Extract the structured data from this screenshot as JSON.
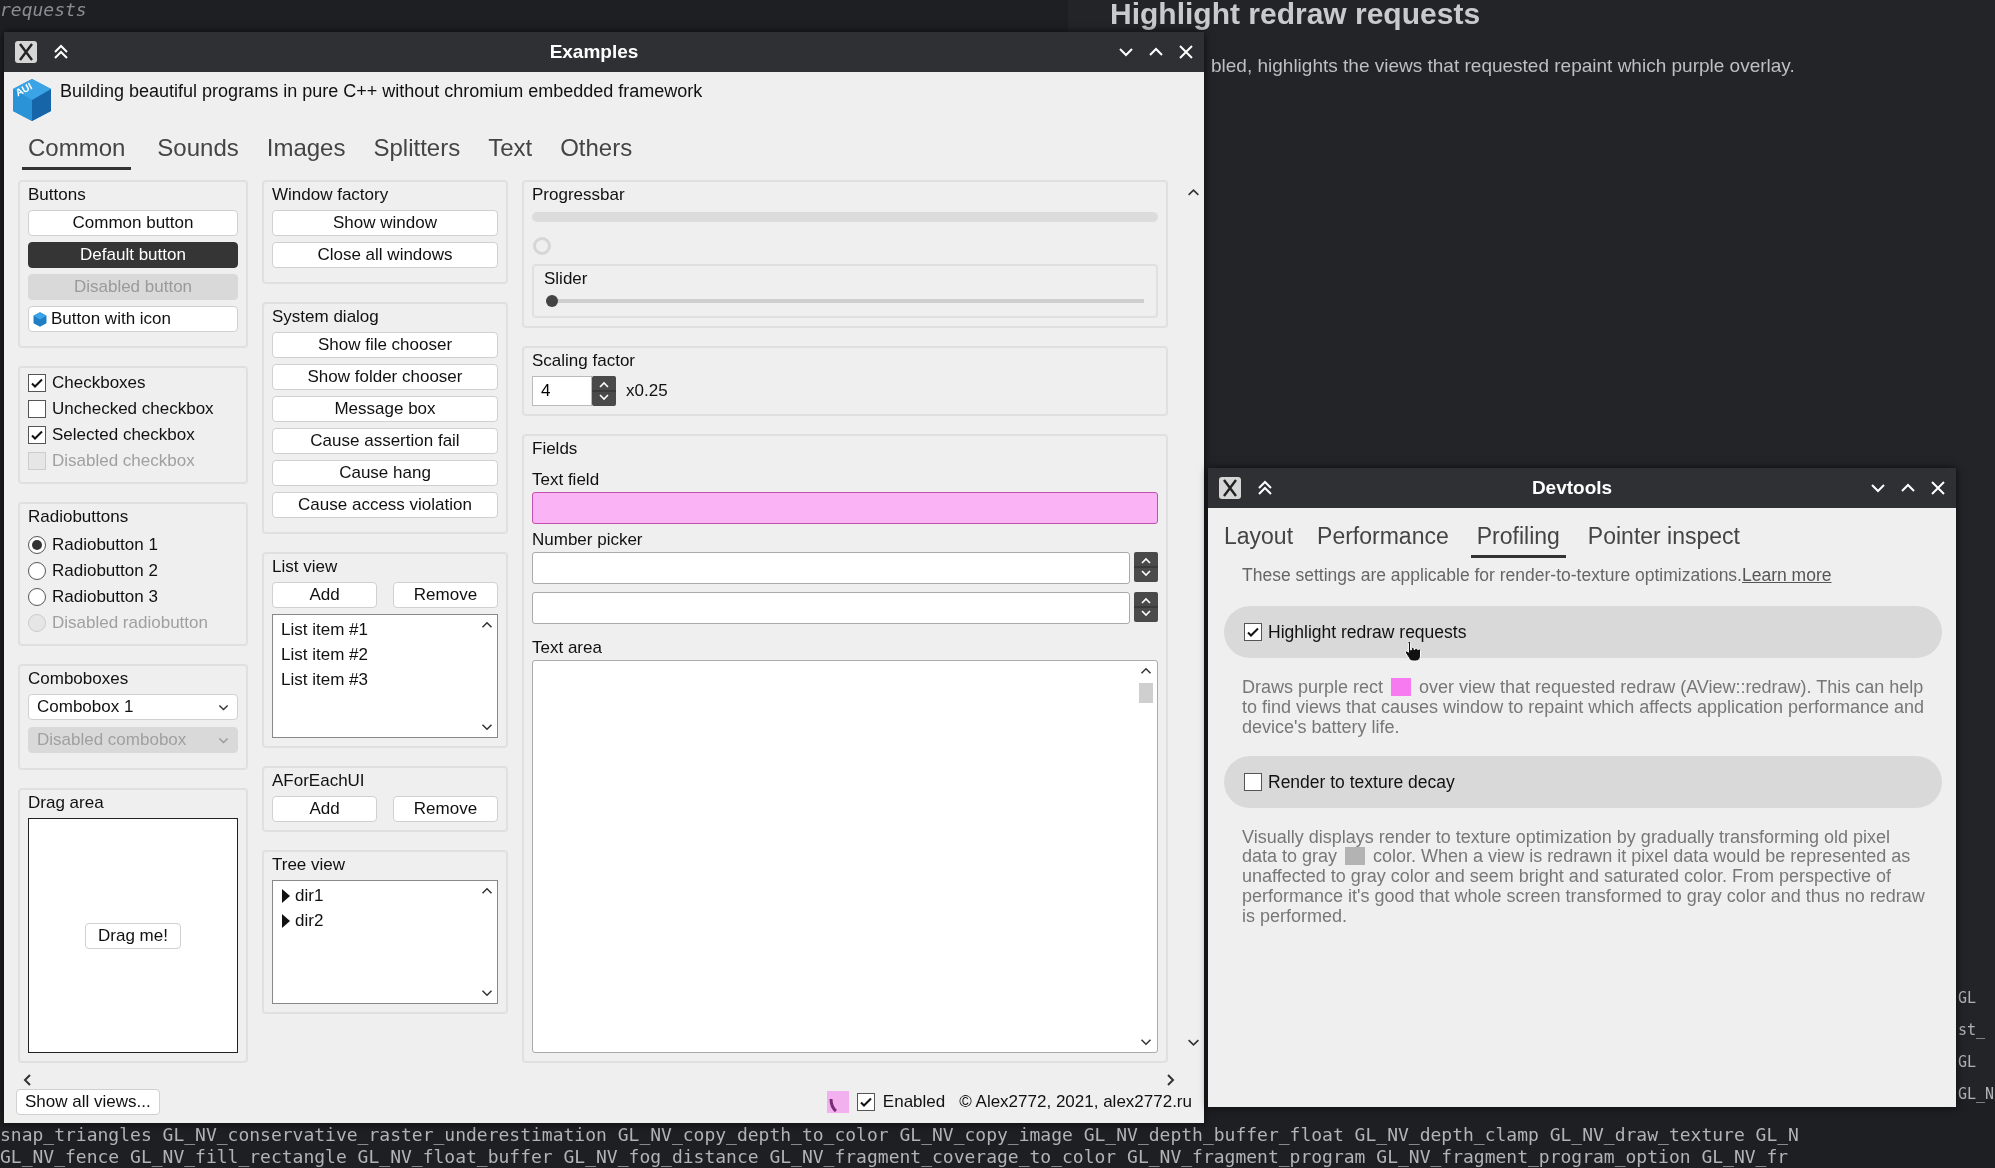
{
  "background": {
    "code_text": "requests",
    "heading": "Highlight redraw requests",
    "paragraph": "bled, highlights the views that requested repaint which purple overlay.",
    "bottom_lines": [
      "snap_triangles GL_NV_conservative_raster_underestimation GL_NV_copy_depth_to_color GL_NV_copy_image GL_NV_depth_buffer_float GL_NV_depth_clamp GL_NV_draw_texture GL_N",
      "GL_NV_fence GL_NV_fill_rectangle GL_NV_float_buffer GL_NV_fog_distance GL_NV_fragment_coverage_to_color GL_NV_fragment_program GL_NV_fragment_program_option GL_NV_fr"
    ],
    "right_fragments": [
      "GL",
      "st_",
      "GL",
      "GL_N"
    ]
  },
  "examples_window": {
    "title": "Examples",
    "logo_text": "AUI",
    "header_text": "Building beautiful programs in pure C++ without chromium embedded framework",
    "tabs": [
      {
        "label": "Common",
        "selected": true
      },
      {
        "label": "Sounds",
        "selected": false
      },
      {
        "label": "Images",
        "selected": false
      },
      {
        "label": "Splitters",
        "selected": false
      },
      {
        "label": "Text",
        "selected": false
      },
      {
        "label": "Others",
        "selected": false
      }
    ],
    "buttons_group": {
      "title": "Buttons",
      "buttons": [
        {
          "label": "Common button",
          "kind": "common"
        },
        {
          "label": "Default button",
          "kind": "default"
        },
        {
          "label": "Disabled button",
          "kind": "disabled"
        },
        {
          "label": "Button with icon",
          "kind": "icon"
        }
      ]
    },
    "checkboxes_group": {
      "title": "Checkboxes",
      "checked": true,
      "items": [
        {
          "label": "Unchecked checkbox",
          "checked": false,
          "disabled": false
        },
        {
          "label": "Selected checkbox",
          "checked": true,
          "disabled": false
        },
        {
          "label": "Disabled checkbox",
          "checked": false,
          "disabled": true
        }
      ]
    },
    "radio_group": {
      "title": "Radiobuttons",
      "items": [
        {
          "label": "Radiobutton 1",
          "selected": true,
          "disabled": false
        },
        {
          "label": "Radiobutton 2",
          "selected": false,
          "disabled": false
        },
        {
          "label": "Radiobutton 3",
          "selected": false,
          "disabled": false
        },
        {
          "label": "Disabled radiobutton",
          "selected": false,
          "disabled": true
        }
      ]
    },
    "combobox_group": {
      "title": "Comboboxes",
      "items": [
        {
          "value": "Combobox 1",
          "disabled": false
        },
        {
          "value": "Disabled combobox",
          "disabled": true
        }
      ]
    },
    "drag_group": {
      "title": "Drag area",
      "button": "Drag me!"
    },
    "window_factory": {
      "title": "Window factory",
      "buttons": [
        "Show window",
        "Close all windows"
      ]
    },
    "system_dialog": {
      "title": "System dialog",
      "buttons": [
        "Show file chooser",
        "Show folder chooser",
        "Message box",
        "Cause assertion fail",
        "Cause hang",
        "Cause access violation"
      ]
    },
    "list_view": {
      "title": "List view",
      "buttons": [
        "Add",
        "Remove"
      ],
      "items": [
        "List item #1",
        "List item #2",
        "List item #3"
      ]
    },
    "foreach": {
      "title": "AForEachUI",
      "buttons": [
        "Add",
        "Remove"
      ]
    },
    "tree_view": {
      "title": "Tree view",
      "items": [
        {
          "label": "dir1",
          "expanded": false
        },
        {
          "label": "dir2",
          "expanded": false
        }
      ]
    },
    "progressbar": {
      "title": "Progressbar",
      "level": 0,
      "slider": {
        "label": "Slider",
        "level": 0
      }
    },
    "scaling": {
      "title": "Scaling factor",
      "value": "4",
      "suffix": "x0.25"
    },
    "fields": {
      "title": "Fields",
      "text_field_label": "Text field",
      "text_field_highlighted": true,
      "number_picker_label": "Number picker",
      "text_area_label": "Text area"
    },
    "status": {
      "button": "Show all views...",
      "enabled_checked": true,
      "enabled_label": "Enabled",
      "copyright": "© Alex2772, 2021, alex2772.ru"
    }
  },
  "devtools_window": {
    "title": "Devtools",
    "tabs": [
      {
        "label": "Layout",
        "selected": false
      },
      {
        "label": "Performance",
        "selected": false
      },
      {
        "label": "Profiling",
        "selected": true
      },
      {
        "label": "Pointer inspect",
        "selected": false
      }
    ],
    "intro": "These settings are applicable for render-to-texture optimizations.",
    "link": "Learn more",
    "options": [
      {
        "label": "Highlight redraw requests",
        "checked": true,
        "desc_before": "Draws purple rect",
        "color": "#f77af0",
        "desc_after": "over view that requested redraw (AView::redraw). This can help to find views that causes window to repaint which affects application performance and device's battery life."
      },
      {
        "label": "Render to texture decay",
        "checked": false,
        "desc_before": "Visually displays render to texture optimization by gradually transforming old pixel  data to gray",
        "color": "#b3b3b3",
        "desc_after": "color. When a view is redrawn it pixel data would be represented as unaffected to gray color and seem bright and saturated color. From perspective of performance it's good that whole screen transformed to gray color and thus no redraw is performed."
      }
    ]
  }
}
